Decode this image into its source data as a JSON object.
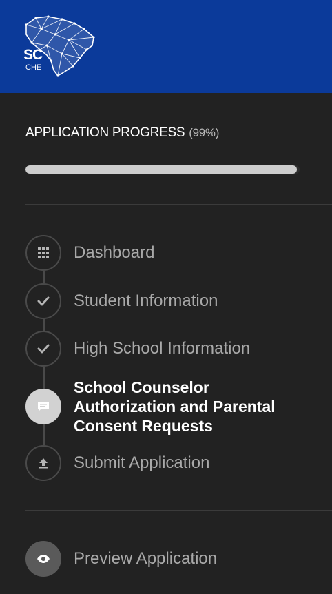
{
  "brand": {
    "logo_sc": "SC",
    "logo_che": "CHE"
  },
  "progress": {
    "title": "APPLICATION PROGRESS",
    "percent_label": "(99%)",
    "value": 0.99
  },
  "steps": [
    {
      "label": "Dashboard",
      "icon": "grid-icon"
    },
    {
      "label": "Student Information",
      "icon": "check-icon"
    },
    {
      "label": "High School Information",
      "icon": "check-icon"
    },
    {
      "label": "School Counselor Authorization and Parental Consent Requests",
      "icon": "chat-icon"
    },
    {
      "label": "Submit Application",
      "icon": "upload-icon"
    }
  ],
  "preview": {
    "label": "Preview Application",
    "icon": "eye-icon"
  }
}
